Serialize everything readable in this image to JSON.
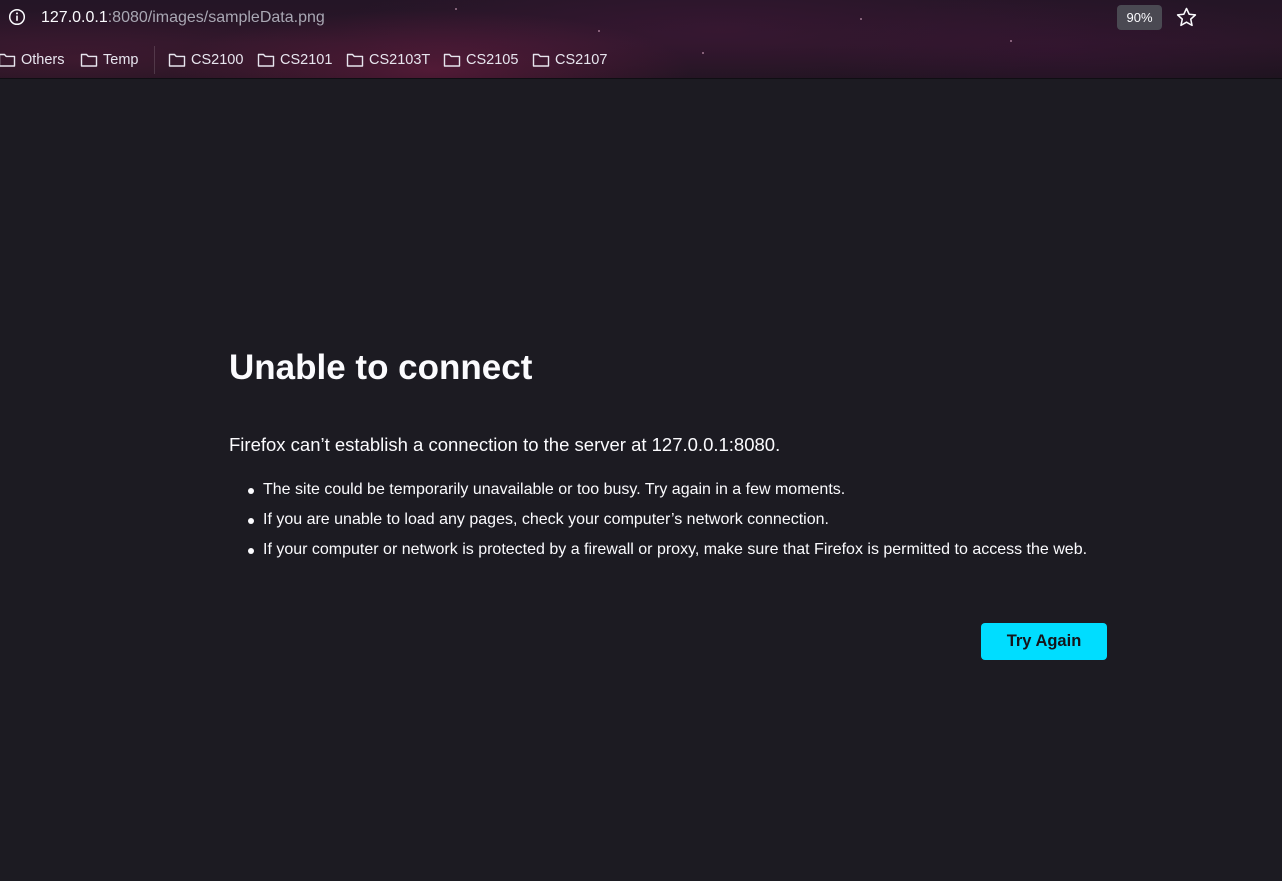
{
  "browser": {
    "url": {
      "host": "127.0.0.1",
      "rest": ":8080/images/sampleData.png"
    },
    "zoom_level": "90%",
    "bookmarks": [
      {
        "label": "Others"
      },
      {
        "label": "Temp"
      },
      {
        "label": "CS2100"
      },
      {
        "label": "CS2101"
      },
      {
        "label": "CS2103T"
      },
      {
        "label": "CS2105"
      },
      {
        "label": "CS2107"
      }
    ]
  },
  "error_page": {
    "title": "Unable to connect",
    "description": "Firefox can’t establish a connection to the server at 127.0.0.1:8080.",
    "reasons": [
      "The site could be temporarily unavailable or too busy. Try again in a few moments.",
      "If you are unable to load any pages, check your computer’s network connection.",
      "If your computer or network is protected by a firewall or proxy, make sure that Firefox is permitted to access the web."
    ],
    "try_again_label": "Try Again",
    "accent_color": "#00ddff",
    "background_color": "#1c1b22"
  }
}
